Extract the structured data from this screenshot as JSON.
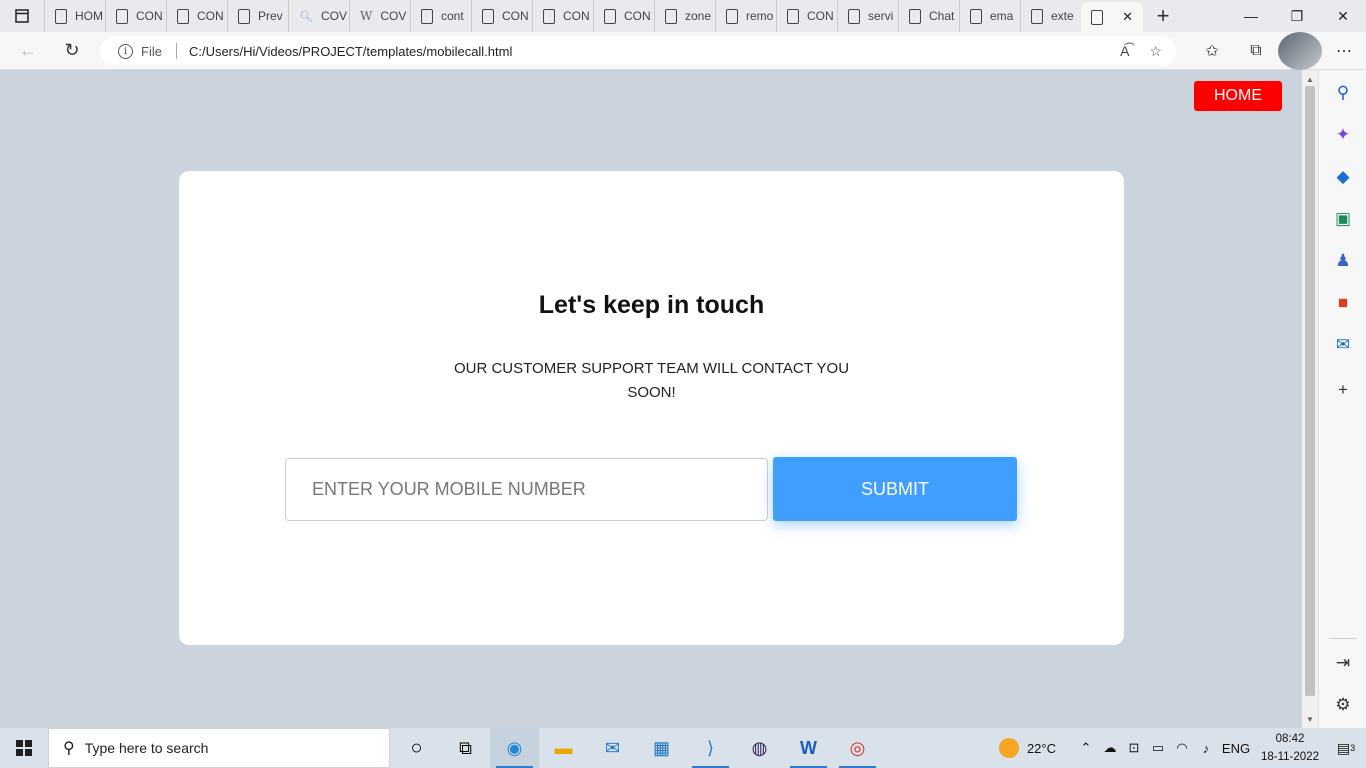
{
  "browser": {
    "tabs": [
      {
        "label": "HOM"
      },
      {
        "label": "CON"
      },
      {
        "label": "CON"
      },
      {
        "label": "Prev"
      },
      {
        "label": "COV"
      },
      {
        "label": "COV"
      },
      {
        "label": "cont"
      },
      {
        "label": "CON"
      },
      {
        "label": "CON"
      },
      {
        "label": "CON"
      },
      {
        "label": "zone"
      },
      {
        "label": "remo"
      },
      {
        "label": "CON"
      },
      {
        "label": "servi"
      },
      {
        "label": "Chat"
      },
      {
        "label": "ema"
      },
      {
        "label": "exte"
      }
    ],
    "active_tab_close": "✕",
    "new_tab": "+",
    "address": {
      "scheme": "File",
      "url": "C:/Users/Hi/Videos/PROJECT/templates/mobilecall.html"
    }
  },
  "page": {
    "home_label": "HOME",
    "title": "Let's keep in touch",
    "subtitle": "OUR CUSTOMER SUPPORT TEAM WILL CONTACT YOU SOON!",
    "phone_placeholder": "ENTER YOUR MOBILE NUMBER",
    "phone_value": "",
    "submit_label": "SUBMIT",
    "colors": {
      "background": "#cbd3dd",
      "home_button": "#ff0000",
      "submit_button": "#409eff"
    }
  },
  "taskbar": {
    "search_placeholder": "Type here to search",
    "weather": "22°C",
    "language": "ENG",
    "time": "08:42",
    "date": "18-11-2022",
    "notifications": "3"
  }
}
